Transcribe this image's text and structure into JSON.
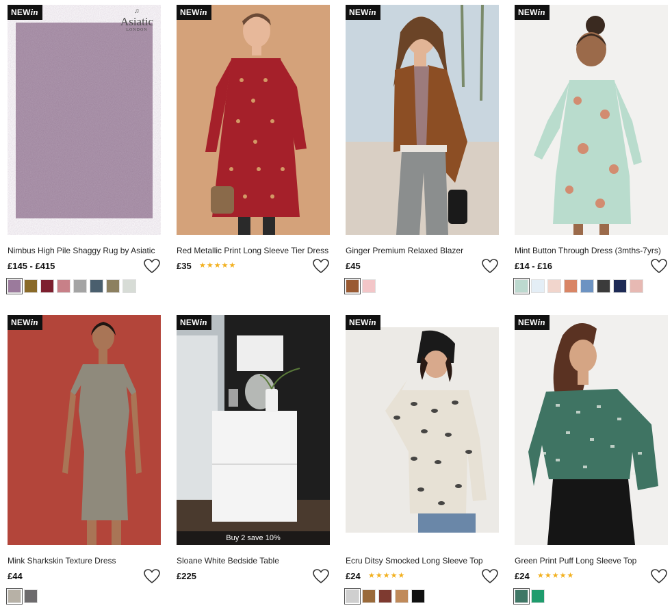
{
  "badge": {
    "new": "NEW",
    "in": "in"
  },
  "products": [
    {
      "id": "rug",
      "new": true,
      "title": "Nimbus High Pile Shaggy Rug by Asiatic",
      "price": "£145 - £415",
      "rating": "",
      "brand_logo": {
        "text": "Asiatic",
        "sub": "LONDON"
      },
      "overlay": "",
      "swatches": [
        "#9b7a9c",
        "#8a6a28",
        "#7d1f2e",
        "#c88088",
        "#a4a4a4",
        "#4a5f6e",
        "#8c8060",
        "#d7dcd6"
      ]
    },
    {
      "id": "red-dress",
      "new": true,
      "title": "Red Metallic Print Long Sleeve Tier Dress",
      "price": "£35",
      "rating": "★★★★★",
      "overlay": "",
      "swatches": []
    },
    {
      "id": "blazer",
      "new": true,
      "title": "Ginger Premium Relaxed Blazer",
      "price": "£45",
      "rating": "",
      "overlay": "",
      "swatches": [
        "#9a5a32",
        "#f3c6c8"
      ]
    },
    {
      "id": "mint-dress",
      "new": true,
      "title": "Mint Button Through Dress (3mths-7yrs)",
      "price": "£14 - £16",
      "rating": "",
      "overlay": "",
      "swatches": [
        "#bcd9cf",
        "#e4eef6",
        "#f1d5cc",
        "#d98565",
        "#6d93c2",
        "#3b3b3b",
        "#1d2a55",
        "#e7b9b3"
      ]
    },
    {
      "id": "mink-dress",
      "new": true,
      "title": "Mink Sharkskin Texture Dress",
      "price": "£44",
      "rating": "",
      "overlay": "",
      "swatches": [
        "#b7b1a6",
        "#6d6b6d"
      ]
    },
    {
      "id": "bedside",
      "new": true,
      "title": "Sloane White Bedside Table",
      "price": "£225",
      "rating": "",
      "overlay": "Buy 2 save 10%",
      "swatches": []
    },
    {
      "id": "ecru-top",
      "new": true,
      "title": "Ecru Ditsy Smocked Long Sleeve Top",
      "price": "£24",
      "rating": "★★★★★",
      "overlay": "",
      "swatches": [
        "#cfcfcf",
        "#9a6a3a",
        "#7e3a30",
        "#c08a5a",
        "#111111"
      ]
    },
    {
      "id": "green-top",
      "new": true,
      "title": "Green Print Puff Long Sleeve Top",
      "price": "£24",
      "rating": "★★★★★",
      "overlay": "",
      "swatches": [
        "#3f7766",
        "#1f9c6d"
      ]
    }
  ],
  "icons": {
    "wishlist": "heart-outline-icon"
  },
  "colors": {
    "rating": "#f2b01e",
    "badge_bg": "#111111"
  }
}
